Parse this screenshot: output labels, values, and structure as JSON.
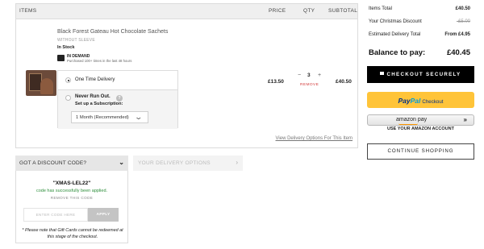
{
  "cart": {
    "headers": {
      "items": "ITEMS",
      "price": "PRICE",
      "qty": "QTY",
      "subtotal": "SUBTOTAL"
    },
    "item": {
      "name": "Black Forest Gateau Hot Chocolate Sachets",
      "variant": "WITHOUT SLEEVE",
      "stock": "In Stock",
      "demand_title": "IN DEMAND",
      "demand_sub": "Purchased 100+ times in the last 48 hours",
      "delivery_options": {
        "one_time": "One Time Delivery",
        "never_run_out": "Never Run Out.",
        "setup_subscription": "Set up a Subscription:",
        "help": "?",
        "selected_frequency": "1 Month (Recommended)"
      },
      "price": "£13.50",
      "qty_minus": "−",
      "qty": "3",
      "qty_plus": "+",
      "remove": "REMOVE",
      "subtotal": "£40.50"
    },
    "view_delivery_link": "View Delivery Options For This Item"
  },
  "summary": {
    "rows": [
      {
        "label": "Items Total",
        "value": "£40.50"
      },
      {
        "label": "Your Christmas Discount",
        "value": "-£5.00"
      },
      {
        "label": "Estimated Delivery Total",
        "value": "From £4.95"
      }
    ],
    "balance_label": "Balance to pay:",
    "balance_value": "£40.45",
    "checkout": "CHECKOUT SECURELY",
    "paypal": {
      "pay": "Pay",
      "pal": "Pal",
      "checkout": "Checkout"
    },
    "amazon": {
      "label": "amazon pay",
      "arrow": "»"
    },
    "use_amazon": "USE YOUR AMAZON ACCOUNT",
    "continue": "CONTINUE SHOPPING"
  },
  "discount": {
    "title": "GOT A DISCOUNT CODE?",
    "chevron": "⌄",
    "code": "\"XMAS-LEL22\"",
    "applied_msg": "code has successfully been applied.",
    "remove_code": "REMOVE THIS CODE",
    "input_placeholder": "ENTER CODE HERE",
    "apply": "APPLY",
    "note": "* Please note that Gift Cards cannot be redeemed at this stage of the checkout."
  },
  "delivery": {
    "title": "YOUR DELIVERY OPTIONS",
    "chevron": "›"
  },
  "colors": {
    "remove_red": "#d23a3a",
    "success_green": "#2f8f3c",
    "paypal_yellow": "#ffc439",
    "paypal_blue": "#003087",
    "paypal_light_blue": "#009cde",
    "checkout_black": "#000000"
  }
}
